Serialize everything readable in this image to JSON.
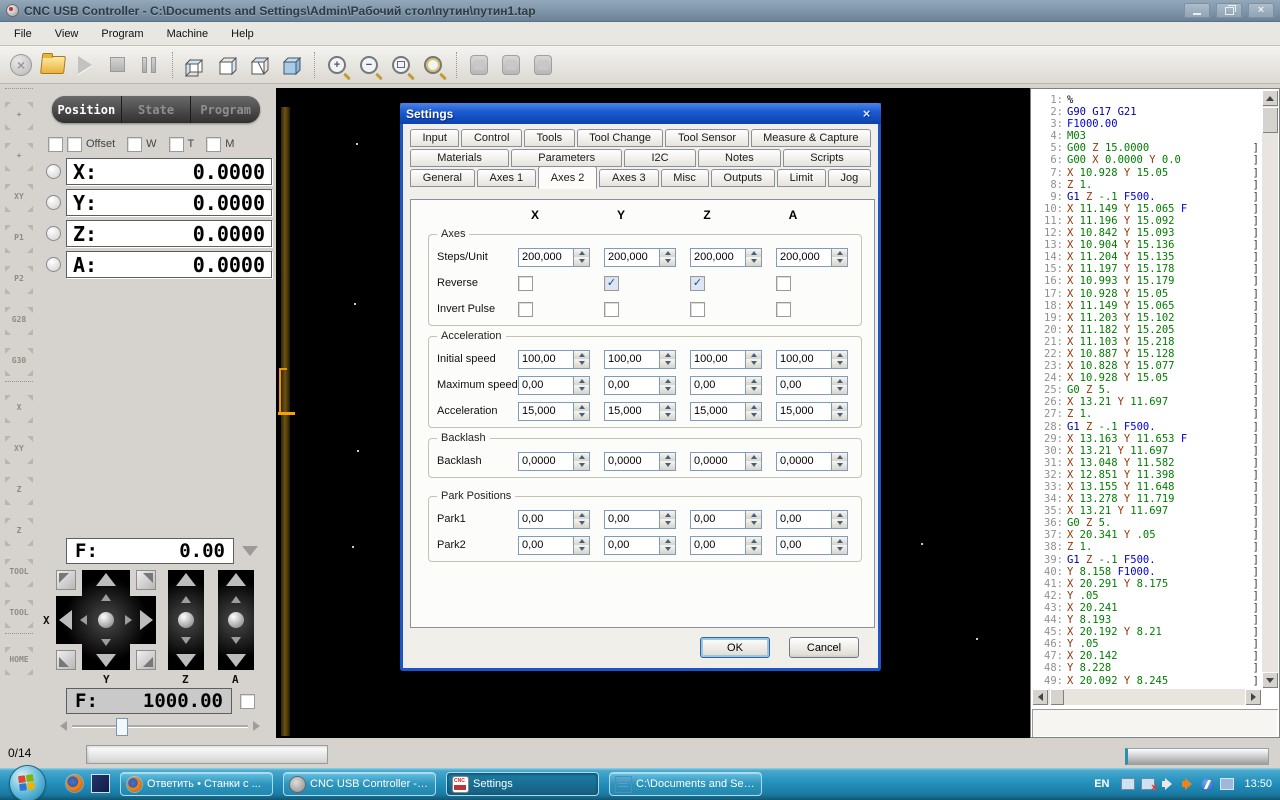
{
  "window": {
    "title": "CNC USB Controller - C:\\Documents and Settings\\Admin\\Рабочий стол\\путин\\путин1.tap",
    "menu": [
      "File",
      "View",
      "Program",
      "Machine",
      "Help"
    ]
  },
  "toolbar": {
    "icons": [
      "cancel-icon",
      "open-file-icon",
      "play-icon",
      "stop-icon",
      "pause-icon",
      "view-perspective-icon",
      "view-side-icon",
      "view-front-icon",
      "view-solid-icon",
      "zoom-in-icon",
      "zoom-out-icon",
      "zoom-window-icon",
      "zoom-selection-icon",
      "machine-icon",
      "spindle-icon",
      "tool-icon"
    ],
    "zoom_in_glyph": "+",
    "zoom_out_glyph": "−"
  },
  "side_strip": {
    "items": [
      "+",
      "+",
      "XY",
      "P1",
      "P2",
      "G28",
      "G30",
      "X",
      "XY",
      "Z",
      "Z",
      "TOOL",
      "TOOL",
      "HOME"
    ]
  },
  "left_panel": {
    "tabs": [
      {
        "label": "Position",
        "active": true
      },
      {
        "label": "State",
        "active": false
      },
      {
        "label": "Program",
        "active": false
      }
    ],
    "option_checkboxes": [
      {
        "label": "",
        "checked": false
      },
      {
        "label": "Offset",
        "checked": false
      },
      {
        "label": "W",
        "checked": false
      },
      {
        "label": "T",
        "checked": false
      },
      {
        "label": "M",
        "checked": false
      }
    ],
    "axis_readouts": [
      {
        "label": "X:",
        "value": "0.0000"
      },
      {
        "label": "Y:",
        "value": "0.0000"
      },
      {
        "label": "Z:",
        "value": "0.0000"
      },
      {
        "label": "A:",
        "value": "0.0000"
      }
    ],
    "feed_actual": {
      "label": "F:",
      "value": "0.00"
    },
    "feed_target": {
      "label": "F:",
      "value": "1000.00",
      "checkbox_checked": false
    },
    "jog": {
      "x_label": "X",
      "y_label": "Y",
      "z_label": "Z",
      "a_label": "A"
    }
  },
  "dialog": {
    "title": "Settings",
    "tab_rows": [
      [
        "Input",
        "Control",
        "Tools",
        "Tool Change",
        "Tool Sensor",
        "Measure & Capture"
      ],
      [
        "Materials",
        "Parameters",
        "I2C",
        "Notes",
        "Scripts"
      ],
      [
        "General",
        "Axes 1",
        "Axes 2",
        "Axes 3",
        "Misc",
        "Outputs",
        "Limit",
        "Jog"
      ]
    ],
    "active_tab": "Axes 2",
    "columns": [
      "X",
      "Y",
      "Z",
      "A"
    ],
    "groups": [
      {
        "title": "Axes",
        "rows": [
          {
            "label": "Steps/Unit",
            "type": "spin",
            "values": [
              "200,000",
              "200,000",
              "200,000",
              "200,000"
            ]
          },
          {
            "label": "Reverse",
            "type": "check",
            "values": [
              false,
              true,
              true,
              false
            ]
          },
          {
            "label": "Invert Pulse",
            "type": "check",
            "values": [
              false,
              false,
              false,
              false
            ]
          }
        ]
      },
      {
        "title": "Acceleration",
        "rows": [
          {
            "label": "Initial speed",
            "type": "spin",
            "values": [
              "100,00",
              "100,00",
              "100,00",
              "100,00"
            ]
          },
          {
            "label": "Maximum speed",
            "type": "spin",
            "values": [
              "0,00",
              "0,00",
              "0,00",
              "0,00"
            ]
          },
          {
            "label": "Acceleration",
            "type": "spin",
            "values": [
              "15,000",
              "15,000",
              "15,000",
              "15,000"
            ]
          }
        ]
      },
      {
        "title": "Backlash",
        "rows": [
          {
            "label": "Backlash",
            "type": "spin",
            "values": [
              "0,0000",
              "0,0000",
              "0,0000",
              "0,0000"
            ]
          }
        ]
      },
      {
        "title": "Park Positions",
        "rows": [
          {
            "label": "Park1",
            "type": "spin",
            "values": [
              "0,00",
              "0,00",
              "0,00",
              "0,00"
            ]
          },
          {
            "label": "Park2",
            "type": "spin",
            "values": [
              "0,00",
              "0,00",
              "0,00",
              "0,00"
            ]
          }
        ]
      }
    ],
    "ok_label": "OK",
    "cancel_label": "Cancel"
  },
  "gcode": {
    "lines": [
      [
        "%",
        0
      ],
      [
        "G90 G17 G21",
        0
      ],
      [
        "F1000.00",
        0
      ],
      [
        "M03",
        0
      ],
      [
        "G00 Z 15.0000",
        1
      ],
      [
        "G00 X 0.0000 Y 0.0",
        1
      ],
      [
        "X 10.928 Y 15.05",
        1
      ],
      [
        "Z 1.",
        1
      ],
      [
        "G1 Z -.1 F500.",
        1
      ],
      [
        "X 11.149 Y 15.065 F",
        1
      ],
      [
        "X 11.196 Y 15.092",
        1
      ],
      [
        "X 10.842 Y 15.093",
        1
      ],
      [
        "X 10.904 Y 15.136",
        1
      ],
      [
        "X 11.204 Y 15.135",
        1
      ],
      [
        "X 11.197 Y 15.178",
        1
      ],
      [
        "X 10.993 Y 15.179",
        1
      ],
      [
        "X 10.928 Y 15.05",
        1
      ],
      [
        "X 11.149 Y 15.065",
        1
      ],
      [
        "X 11.203 Y 15.102",
        1
      ],
      [
        "X 11.182 Y 15.205",
        1
      ],
      [
        "X 11.103 Y 15.218",
        1
      ],
      [
        "X 10.887 Y 15.128",
        1
      ],
      [
        "X 10.828 Y 15.077",
        1
      ],
      [
        "X 10.928 Y 15.05",
        1
      ],
      [
        "G0 Z 5.",
        1
      ],
      [
        "X 13.21 Y 11.697",
        1
      ],
      [
        "Z 1.",
        1
      ],
      [
        "G1 Z -.1 F500.",
        1
      ],
      [
        "X 13.163 Y 11.653 F",
        1
      ],
      [
        "X 13.21 Y 11.697",
        1
      ],
      [
        "X 13.048 Y 11.582",
        1
      ],
      [
        "X 12.851 Y 11.398",
        1
      ],
      [
        "X 13.155 Y 11.648",
        1
      ],
      [
        "X 13.278 Y 11.719",
        1
      ],
      [
        "X 13.21 Y 11.697",
        1
      ],
      [
        "G0 Z 5.",
        1
      ],
      [
        "X 20.341 Y .05",
        1
      ],
      [
        "Z 1.",
        1
      ],
      [
        "G1 Z -.1 F500.",
        1
      ],
      [
        "Y 8.158 F1000.",
        1
      ],
      [
        "X 20.291 Y 8.175",
        1
      ],
      [
        "Y .05",
        1
      ],
      [
        "X 20.241",
        1
      ],
      [
        "Y 8.193",
        1
      ],
      [
        "X 20.192 Y 8.21",
        1
      ],
      [
        "Y .05",
        1
      ],
      [
        "X 20.142",
        1
      ],
      [
        "Y 8.228",
        1
      ],
      [
        "X 20.092 Y 8.245",
        1
      ]
    ],
    "colors": {
      "line_number": "#909090",
      "g_motion_green": "#007d00",
      "g_modal_navy": "#00009c",
      "feed_blue": "#0000e0",
      "axis_letter_maroon": "#993300",
      "number_green": "#007d00",
      "plain_black": "#000000"
    }
  },
  "statusbar": {
    "progress_label": "0/14"
  },
  "taskbar": {
    "tasks": [
      {
        "label": "Ответить • Станки с ...",
        "icon": "firefox-icon",
        "active": false
      },
      {
        "label": "CNC USB Controller - C...",
        "icon": "cnc-app-icon",
        "active": false
      },
      {
        "label": "Settings",
        "icon": "cnc-logo-icon",
        "active": true
      },
      {
        "label": "C:\\Documents and Sett...",
        "icon": "document-icon",
        "active": false
      }
    ],
    "tray": {
      "language": "EN",
      "clock": "13:50",
      "icons": [
        "monitor-audio-icon",
        "network-error-icon",
        "volume-icon",
        "speaker-orange-icon",
        "power-icon",
        "tablet-icon"
      ]
    }
  }
}
